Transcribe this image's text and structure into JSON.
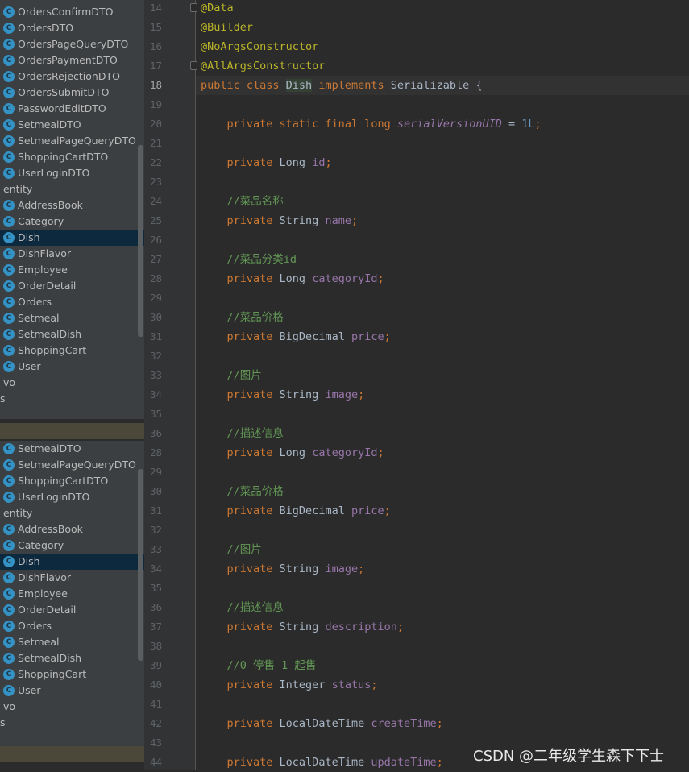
{
  "tree_top": {
    "items": [
      {
        "kind": "class",
        "label": "OrdersConfirmDTO"
      },
      {
        "kind": "class",
        "label": "OrdersDTO"
      },
      {
        "kind": "class",
        "label": "OrdersPageQueryDTO"
      },
      {
        "kind": "class",
        "label": "OrdersPaymentDTO"
      },
      {
        "kind": "class",
        "label": "OrdersRejectionDTO"
      },
      {
        "kind": "class",
        "label": "OrdersSubmitDTO"
      },
      {
        "kind": "class",
        "label": "PasswordEditDTO"
      },
      {
        "kind": "class",
        "label": "SetmealDTO"
      },
      {
        "kind": "class",
        "label": "SetmealPageQueryDTO"
      },
      {
        "kind": "class",
        "label": "ShoppingCartDTO"
      },
      {
        "kind": "class",
        "label": "UserLoginDTO"
      },
      {
        "kind": "folder",
        "label": "entity"
      },
      {
        "kind": "class",
        "label": "AddressBook"
      },
      {
        "kind": "class",
        "label": "Category"
      },
      {
        "kind": "class",
        "label": "Dish",
        "selected": true
      },
      {
        "kind": "class",
        "label": "DishFlavor"
      },
      {
        "kind": "class",
        "label": "Employee"
      },
      {
        "kind": "class",
        "label": "OrderDetail"
      },
      {
        "kind": "class",
        "label": "Orders"
      },
      {
        "kind": "class",
        "label": "Setmeal"
      },
      {
        "kind": "class",
        "label": "SetmealDish"
      },
      {
        "kind": "class",
        "label": "ShoppingCart"
      },
      {
        "kind": "class",
        "label": "User"
      },
      {
        "kind": "folder",
        "label": "vo"
      },
      {
        "kind": "tail",
        "label": "s"
      }
    ]
  },
  "tree_bottom": {
    "items": [
      {
        "kind": "class",
        "label": "SetmealDTO"
      },
      {
        "kind": "class",
        "label": "SetmealPageQueryDTO"
      },
      {
        "kind": "class",
        "label": "ShoppingCartDTO"
      },
      {
        "kind": "class",
        "label": "UserLoginDTO"
      },
      {
        "kind": "folder",
        "label": "entity"
      },
      {
        "kind": "class",
        "label": "AddressBook"
      },
      {
        "kind": "class",
        "label": "Category"
      },
      {
        "kind": "class",
        "label": "Dish",
        "selected": true
      },
      {
        "kind": "class",
        "label": "DishFlavor"
      },
      {
        "kind": "class",
        "label": "Employee"
      },
      {
        "kind": "class",
        "label": "OrderDetail"
      },
      {
        "kind": "class",
        "label": "Orders"
      },
      {
        "kind": "class",
        "label": "Setmeal"
      },
      {
        "kind": "class",
        "label": "SetmealDish"
      },
      {
        "kind": "class",
        "label": "ShoppingCart"
      },
      {
        "kind": "class",
        "label": "User"
      },
      {
        "kind": "folder",
        "label": "vo"
      },
      {
        "kind": "tail",
        "label": "s"
      }
    ]
  },
  "class_icon_letter": "C",
  "editor": {
    "current_line": "18",
    "lines": [
      {
        "num": "14",
        "tokens": [
          {
            "t": "ann",
            "v": "@Data"
          }
        ]
      },
      {
        "num": "15",
        "tokens": [
          {
            "t": "ann",
            "v": "@Builder"
          }
        ]
      },
      {
        "num": "16",
        "tokens": [
          {
            "t": "ann",
            "v": "@NoArgsConstructor"
          }
        ]
      },
      {
        "num": "17",
        "tokens": [
          {
            "t": "ann",
            "v": "@AllArgsConstructor"
          }
        ]
      },
      {
        "num": "18",
        "tokens": [
          {
            "t": "kw",
            "v": "public class "
          },
          {
            "t": "hl",
            "v": "Dish"
          },
          {
            "t": "type",
            "v": " "
          },
          {
            "t": "kw",
            "v": "implements "
          },
          {
            "t": "type",
            "v": "Serializable {"
          }
        ]
      },
      {
        "num": "19",
        "tokens": []
      },
      {
        "num": "20",
        "tokens": [
          {
            "t": "type",
            "v": "    "
          },
          {
            "t": "kw",
            "v": "private static final long "
          },
          {
            "t": "static",
            "v": "serialVersionUID"
          },
          {
            "t": "type",
            "v": " = "
          },
          {
            "t": "num",
            "v": "1L"
          },
          {
            "t": "punc",
            "v": ";"
          }
        ]
      },
      {
        "num": "21",
        "tokens": []
      },
      {
        "num": "22",
        "tokens": [
          {
            "t": "type",
            "v": "    "
          },
          {
            "t": "kw",
            "v": "private "
          },
          {
            "t": "type",
            "v": "Long "
          },
          {
            "t": "field",
            "v": "id"
          },
          {
            "t": "punc",
            "v": ";"
          }
        ]
      },
      {
        "num": "23",
        "tokens": []
      },
      {
        "num": "24",
        "tokens": [
          {
            "t": "type",
            "v": "    "
          },
          {
            "t": "comment",
            "v": "//菜品名称"
          }
        ]
      },
      {
        "num": "25",
        "tokens": [
          {
            "t": "type",
            "v": "    "
          },
          {
            "t": "kw",
            "v": "private "
          },
          {
            "t": "type",
            "v": "String "
          },
          {
            "t": "field",
            "v": "name"
          },
          {
            "t": "punc",
            "v": ";"
          }
        ]
      },
      {
        "num": "26",
        "tokens": []
      },
      {
        "num": "27",
        "tokens": [
          {
            "t": "type",
            "v": "    "
          },
          {
            "t": "comment",
            "v": "//菜品分类id"
          }
        ]
      },
      {
        "num": "28",
        "tokens": [
          {
            "t": "type",
            "v": "    "
          },
          {
            "t": "kw",
            "v": "private "
          },
          {
            "t": "type",
            "v": "Long "
          },
          {
            "t": "field",
            "v": "categoryId"
          },
          {
            "t": "punc",
            "v": ";"
          }
        ]
      },
      {
        "num": "29",
        "tokens": []
      },
      {
        "num": "30",
        "tokens": [
          {
            "t": "type",
            "v": "    "
          },
          {
            "t": "comment",
            "v": "//菜品价格"
          }
        ]
      },
      {
        "num": "31",
        "tokens": [
          {
            "t": "type",
            "v": "    "
          },
          {
            "t": "kw",
            "v": "private "
          },
          {
            "t": "type",
            "v": "BigDecimal "
          },
          {
            "t": "field",
            "v": "price"
          },
          {
            "t": "punc",
            "v": ";"
          }
        ]
      },
      {
        "num": "32",
        "tokens": []
      },
      {
        "num": "33",
        "tokens": [
          {
            "t": "type",
            "v": "    "
          },
          {
            "t": "comment",
            "v": "//图片"
          }
        ]
      },
      {
        "num": "34",
        "tokens": [
          {
            "t": "type",
            "v": "    "
          },
          {
            "t": "kw",
            "v": "private "
          },
          {
            "t": "type",
            "v": "String "
          },
          {
            "t": "field",
            "v": "image"
          },
          {
            "t": "punc",
            "v": ";"
          }
        ]
      },
      {
        "num": "35",
        "tokens": []
      },
      {
        "num": "36",
        "tokens": [
          {
            "t": "type",
            "v": "    "
          },
          {
            "t": "comment",
            "v": "//描述信息"
          }
        ]
      },
      {
        "num": "28",
        "tokens": [
          {
            "t": "type",
            "v": "    "
          },
          {
            "t": "kw",
            "v": "private "
          },
          {
            "t": "type",
            "v": "Long "
          },
          {
            "t": "field",
            "v": "categoryId"
          },
          {
            "t": "punc",
            "v": ";"
          }
        ]
      },
      {
        "num": "29",
        "tokens": []
      },
      {
        "num": "30",
        "tokens": [
          {
            "t": "type",
            "v": "    "
          },
          {
            "t": "comment",
            "v": "//菜品价格"
          }
        ]
      },
      {
        "num": "31",
        "tokens": [
          {
            "t": "type",
            "v": "    "
          },
          {
            "t": "kw",
            "v": "private "
          },
          {
            "t": "type",
            "v": "BigDecimal "
          },
          {
            "t": "field",
            "v": "price"
          },
          {
            "t": "punc",
            "v": ";"
          }
        ]
      },
      {
        "num": "32",
        "tokens": []
      },
      {
        "num": "33",
        "tokens": [
          {
            "t": "type",
            "v": "    "
          },
          {
            "t": "comment",
            "v": "//图片"
          }
        ]
      },
      {
        "num": "34",
        "tokens": [
          {
            "t": "type",
            "v": "    "
          },
          {
            "t": "kw",
            "v": "private "
          },
          {
            "t": "type",
            "v": "String "
          },
          {
            "t": "field",
            "v": "image"
          },
          {
            "t": "punc",
            "v": ";"
          }
        ]
      },
      {
        "num": "35",
        "tokens": []
      },
      {
        "num": "36",
        "tokens": [
          {
            "t": "type",
            "v": "    "
          },
          {
            "t": "comment",
            "v": "//描述信息"
          }
        ]
      },
      {
        "num": "37",
        "tokens": [
          {
            "t": "type",
            "v": "    "
          },
          {
            "t": "kw",
            "v": "private "
          },
          {
            "t": "type",
            "v": "String "
          },
          {
            "t": "field",
            "v": "description"
          },
          {
            "t": "punc",
            "v": ";"
          }
        ]
      },
      {
        "num": "38",
        "tokens": []
      },
      {
        "num": "39",
        "tokens": [
          {
            "t": "type",
            "v": "    "
          },
          {
            "t": "comment",
            "v": "//0 停售 1 起售"
          }
        ]
      },
      {
        "num": "40",
        "tokens": [
          {
            "t": "type",
            "v": "    "
          },
          {
            "t": "kw",
            "v": "private "
          },
          {
            "t": "type",
            "v": "Integer "
          },
          {
            "t": "field",
            "v": "status"
          },
          {
            "t": "punc",
            "v": ";"
          }
        ]
      },
      {
        "num": "41",
        "tokens": []
      },
      {
        "num": "42",
        "tokens": [
          {
            "t": "type",
            "v": "    "
          },
          {
            "t": "kw",
            "v": "private "
          },
          {
            "t": "type",
            "v": "LocalDateTime "
          },
          {
            "t": "field",
            "v": "createTime"
          },
          {
            "t": "punc",
            "v": ";"
          }
        ]
      },
      {
        "num": "43",
        "tokens": []
      },
      {
        "num": "44",
        "tokens": [
          {
            "t": "type",
            "v": "    "
          },
          {
            "t": "kw",
            "v": "private "
          },
          {
            "t": "type",
            "v": "LocalDateTime "
          },
          {
            "t": "field",
            "v": "updateTime"
          },
          {
            "t": "punc",
            "v": ";"
          }
        ]
      }
    ]
  },
  "watermark": "CSDN @二年级学生森下下士",
  "colors": {
    "background": "#2b2b2b",
    "annotation": "#bbb529",
    "keyword": "#cc7832",
    "field": "#9876aa",
    "number": "#6897bb",
    "comment": "#629755",
    "selection": "#0d293e"
  }
}
